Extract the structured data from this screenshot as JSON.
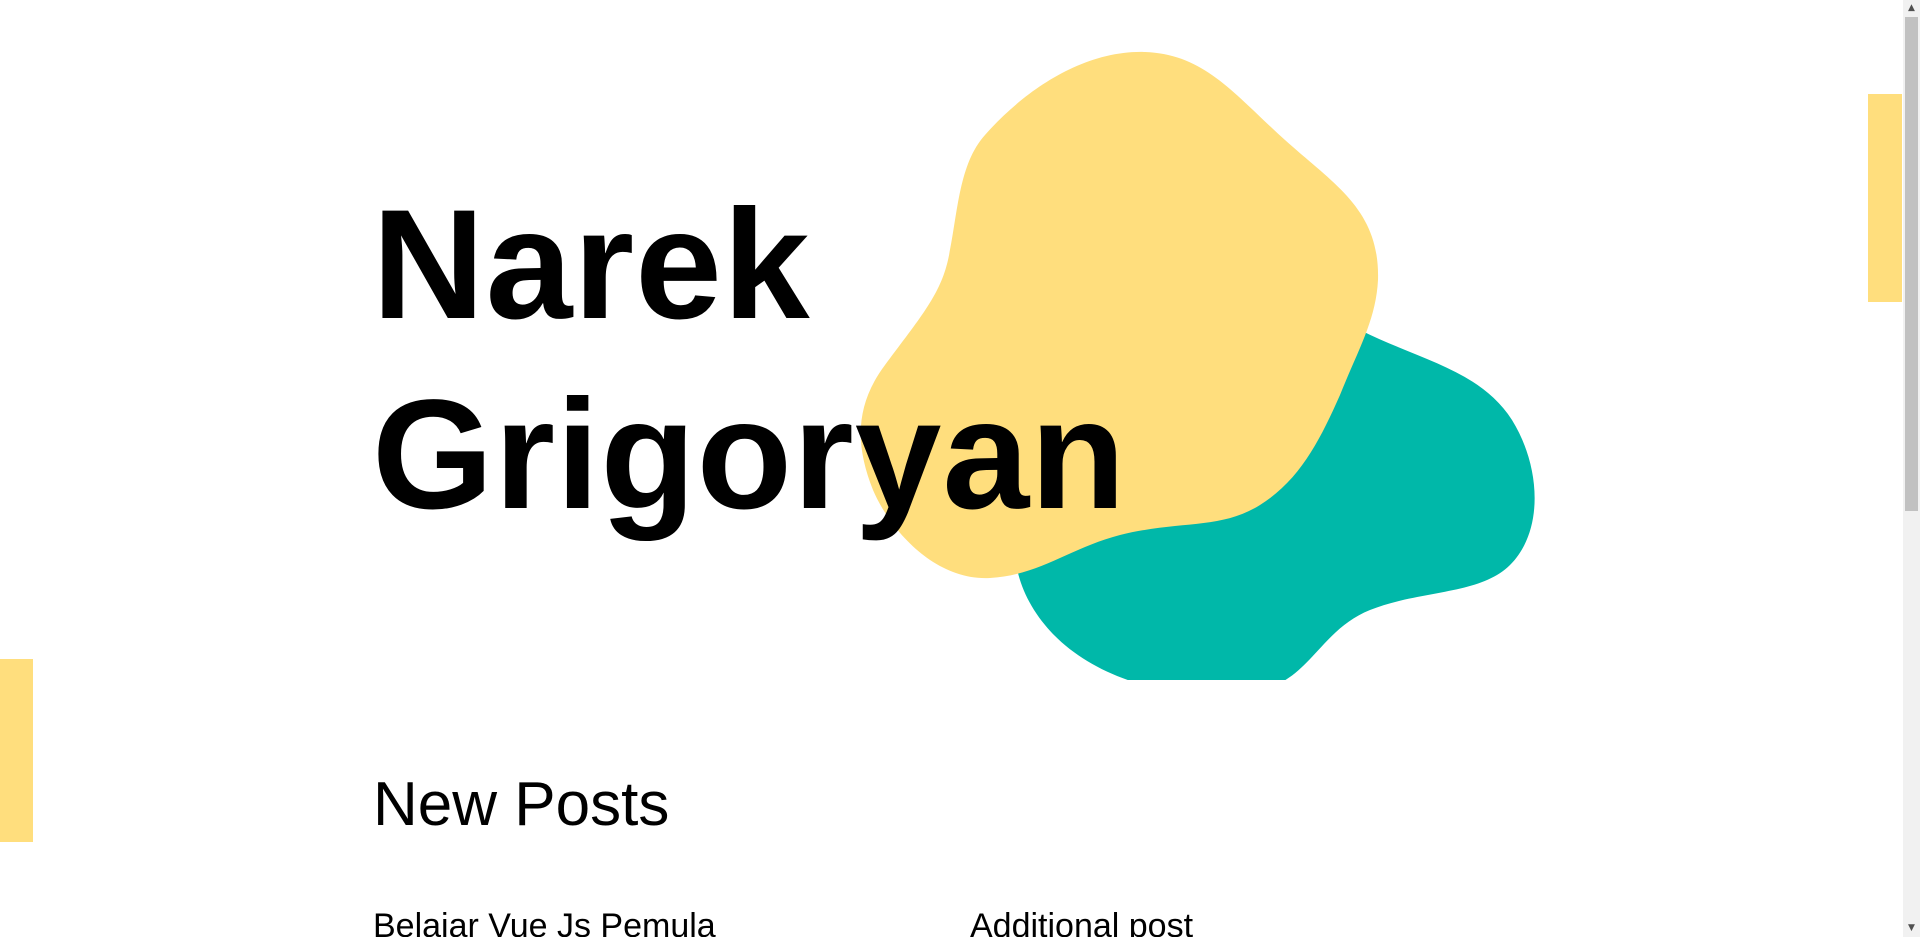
{
  "hero": {
    "first_name": "Narek",
    "last_name": "Grigoryan"
  },
  "colors": {
    "yellow": "#ffde7d",
    "teal": "#00b8a9",
    "text": "#000000",
    "background": "#ffffff"
  },
  "decor": {
    "blob_front": "yellow-blob",
    "blob_back": "teal-blob"
  },
  "posts_section": {
    "title": "New Posts",
    "items": [
      {
        "title": "Belajar Vue Js Pemula"
      },
      {
        "title": "Additional post"
      }
    ]
  },
  "scrollbar": {
    "up_icon": "▲",
    "down_icon": "▼"
  }
}
